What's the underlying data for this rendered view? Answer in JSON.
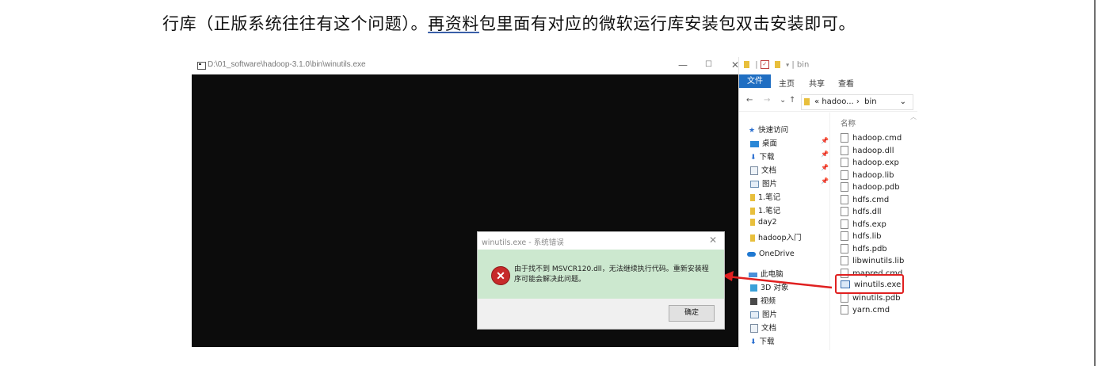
{
  "document": {
    "line_before": "行库（正版系统往往有这个问题）。",
    "link_text": "再资料",
    "line_after": "包里面有对应的微软运行库安装包双击安装即可。"
  },
  "console": {
    "title": "D:\\01_software\\hadoop-3.1.0\\bin\\winutils.exe",
    "minimize": "—",
    "maximize": "☐",
    "close": "✕"
  },
  "explorer": {
    "title": "bin",
    "quick_access_sep": "|",
    "ribbon_tabs": [
      "文件",
      "主页",
      "共享",
      "查看"
    ],
    "nav_back": "←",
    "nav_forward": "→",
    "nav_recent": "⌄",
    "nav_up": "↑",
    "address_prefix": "«",
    "address_folder": "hadoo...",
    "address_sep": "›",
    "address_current": "bin",
    "address_dropdown": "⌄",
    "column_header": "名称",
    "sidebar": [
      {
        "label": "快速访问",
        "icon": "star-icon"
      },
      {
        "label": "桌面",
        "icon": "desktop-icon",
        "pinned": true
      },
      {
        "label": "下载",
        "icon": "download-icon",
        "pinned": true
      },
      {
        "label": "文档",
        "icon": "document-icon",
        "pinned": true
      },
      {
        "label": "图片",
        "icon": "picture-icon",
        "pinned": true
      },
      {
        "label": "1.笔记",
        "icon": "folder-icon"
      },
      {
        "label": "1.笔记",
        "icon": "folder-icon"
      },
      {
        "label": "day2",
        "icon": "folder-icon"
      },
      {
        "label": "hadoop入门",
        "icon": "folder-icon"
      },
      {
        "label": "OneDrive",
        "icon": "cloud-icon"
      },
      {
        "label": "此电脑",
        "icon": "computer-icon"
      },
      {
        "label": "3D 对象",
        "icon": "cube-icon"
      },
      {
        "label": "视频",
        "icon": "video-icon"
      },
      {
        "label": "图片",
        "icon": "picture-icon"
      },
      {
        "label": "文档",
        "icon": "document-icon"
      },
      {
        "label": "下载",
        "icon": "download-icon"
      }
    ],
    "pin_glyph": "📌",
    "files": [
      {
        "name": "hadoop.cmd",
        "type": "cmd"
      },
      {
        "name": "hadoop.dll",
        "type": "dll"
      },
      {
        "name": "hadoop.exp",
        "type": "file"
      },
      {
        "name": "hadoop.lib",
        "type": "file"
      },
      {
        "name": "hadoop.pdb",
        "type": "file"
      },
      {
        "name": "hdfs.cmd",
        "type": "cmd"
      },
      {
        "name": "hdfs.dll",
        "type": "dll"
      },
      {
        "name": "hdfs.exp",
        "type": "file"
      },
      {
        "name": "hdfs.lib",
        "type": "file"
      },
      {
        "name": "hdfs.pdb",
        "type": "file"
      },
      {
        "name": "libwinutils.lib",
        "type": "file"
      },
      {
        "name": "mapred.cmd",
        "type": "cmd"
      },
      {
        "name": "winutils.exe",
        "type": "exe",
        "highlighted": true
      },
      {
        "name": "winutils.pdb",
        "type": "file"
      },
      {
        "name": "yarn.cmd",
        "type": "cmd"
      }
    ]
  },
  "dialog": {
    "title": "winutils.exe - 系统错误",
    "close": "✕",
    "icon_glyph": "✕",
    "message": "由于找不到 MSVCR120.dll，无法继续执行代码。重新安装程序可能会解决此问题。",
    "ok_label": "确定"
  },
  "colors": {
    "console_bg": "#0c0c0c",
    "dialog_body_bg": "#cce8cf",
    "error_red": "#c72a2a",
    "annotation_red": "#e02020",
    "ribbon_blue": "#1f6ec2"
  }
}
